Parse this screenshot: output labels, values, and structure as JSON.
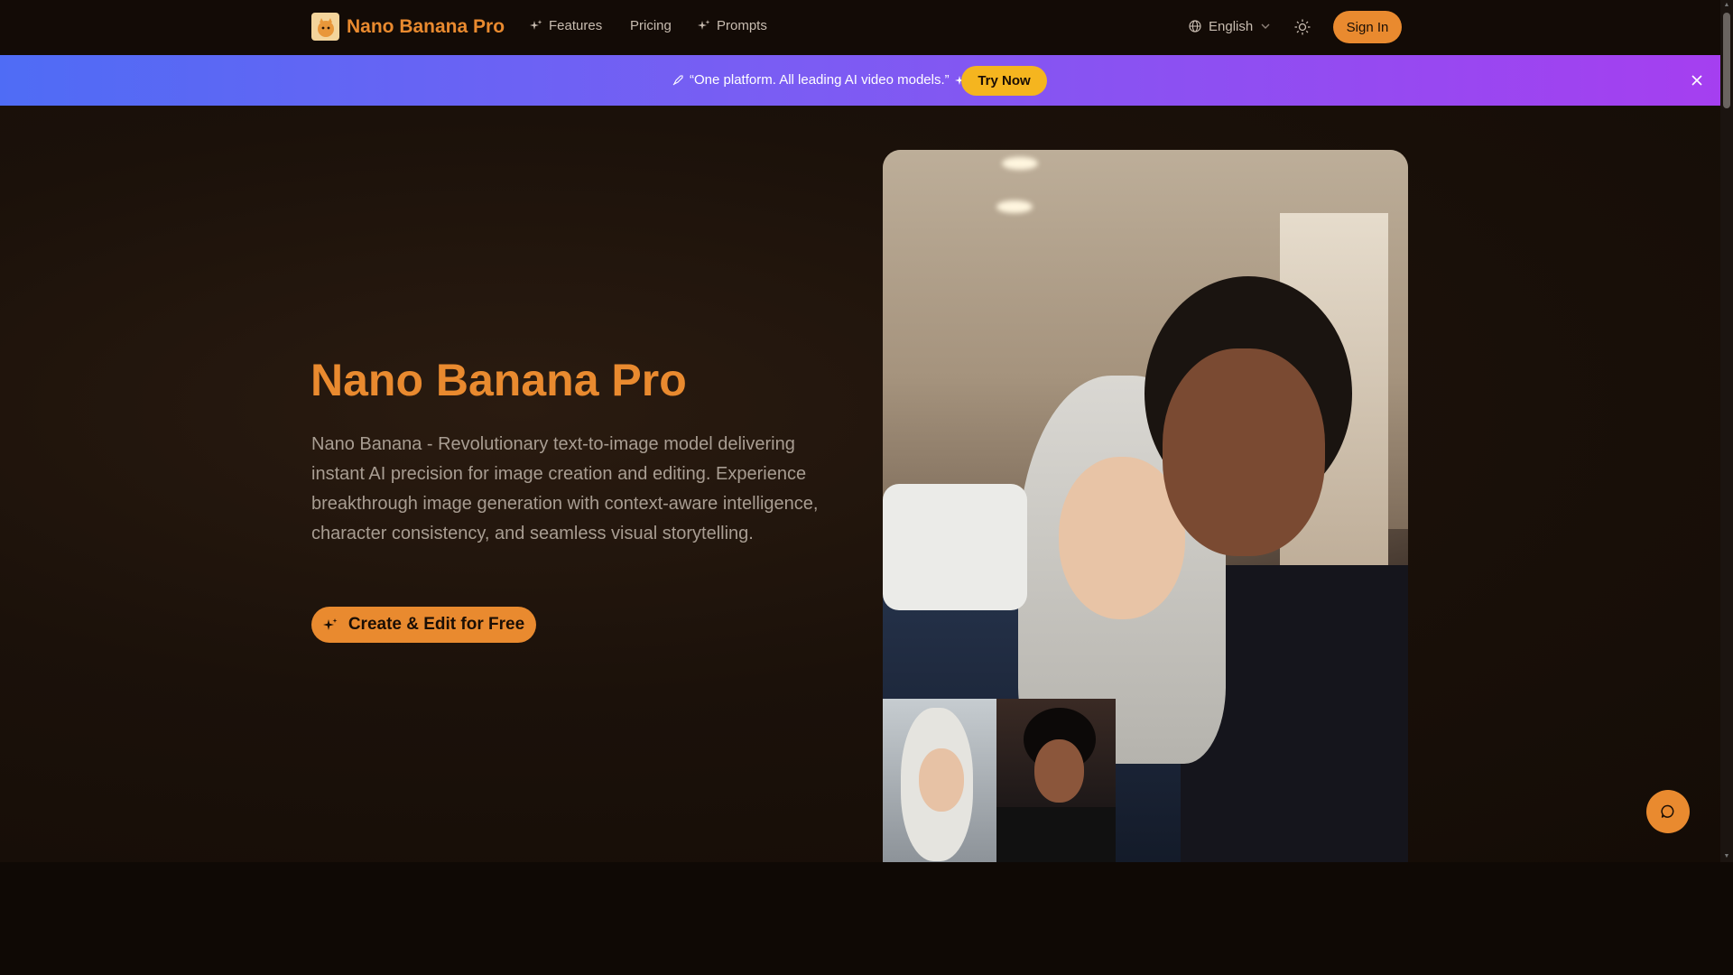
{
  "nav": {
    "brand": "Nano Banana Pro",
    "items": [
      {
        "label": "Features",
        "icon": "sparkle-icon"
      },
      {
        "label": "Pricing",
        "icon": ""
      },
      {
        "label": "Prompts",
        "icon": "sparkle-icon"
      }
    ],
    "language": "English",
    "sign_in": "Sign In"
  },
  "banner": {
    "text": "“One platform. All leading AI video models.”",
    "cta": "Try Now"
  },
  "hero": {
    "title": "Nano Banana Pro",
    "description": "Nano Banana - Revolutionary text-to-image model delivering instant AI precision for image creation and editing. Experience breakthrough image generation with context-aware intelligence, character consistency, and seamless visual storytelling.",
    "cta": "Create & Edit for Free"
  },
  "colors": {
    "accent": "#e98a2f",
    "try_button": "#f5b51f",
    "banner_start": "#4f6cf5",
    "banner_end": "#a53ff0",
    "background": "#0f0905"
  }
}
